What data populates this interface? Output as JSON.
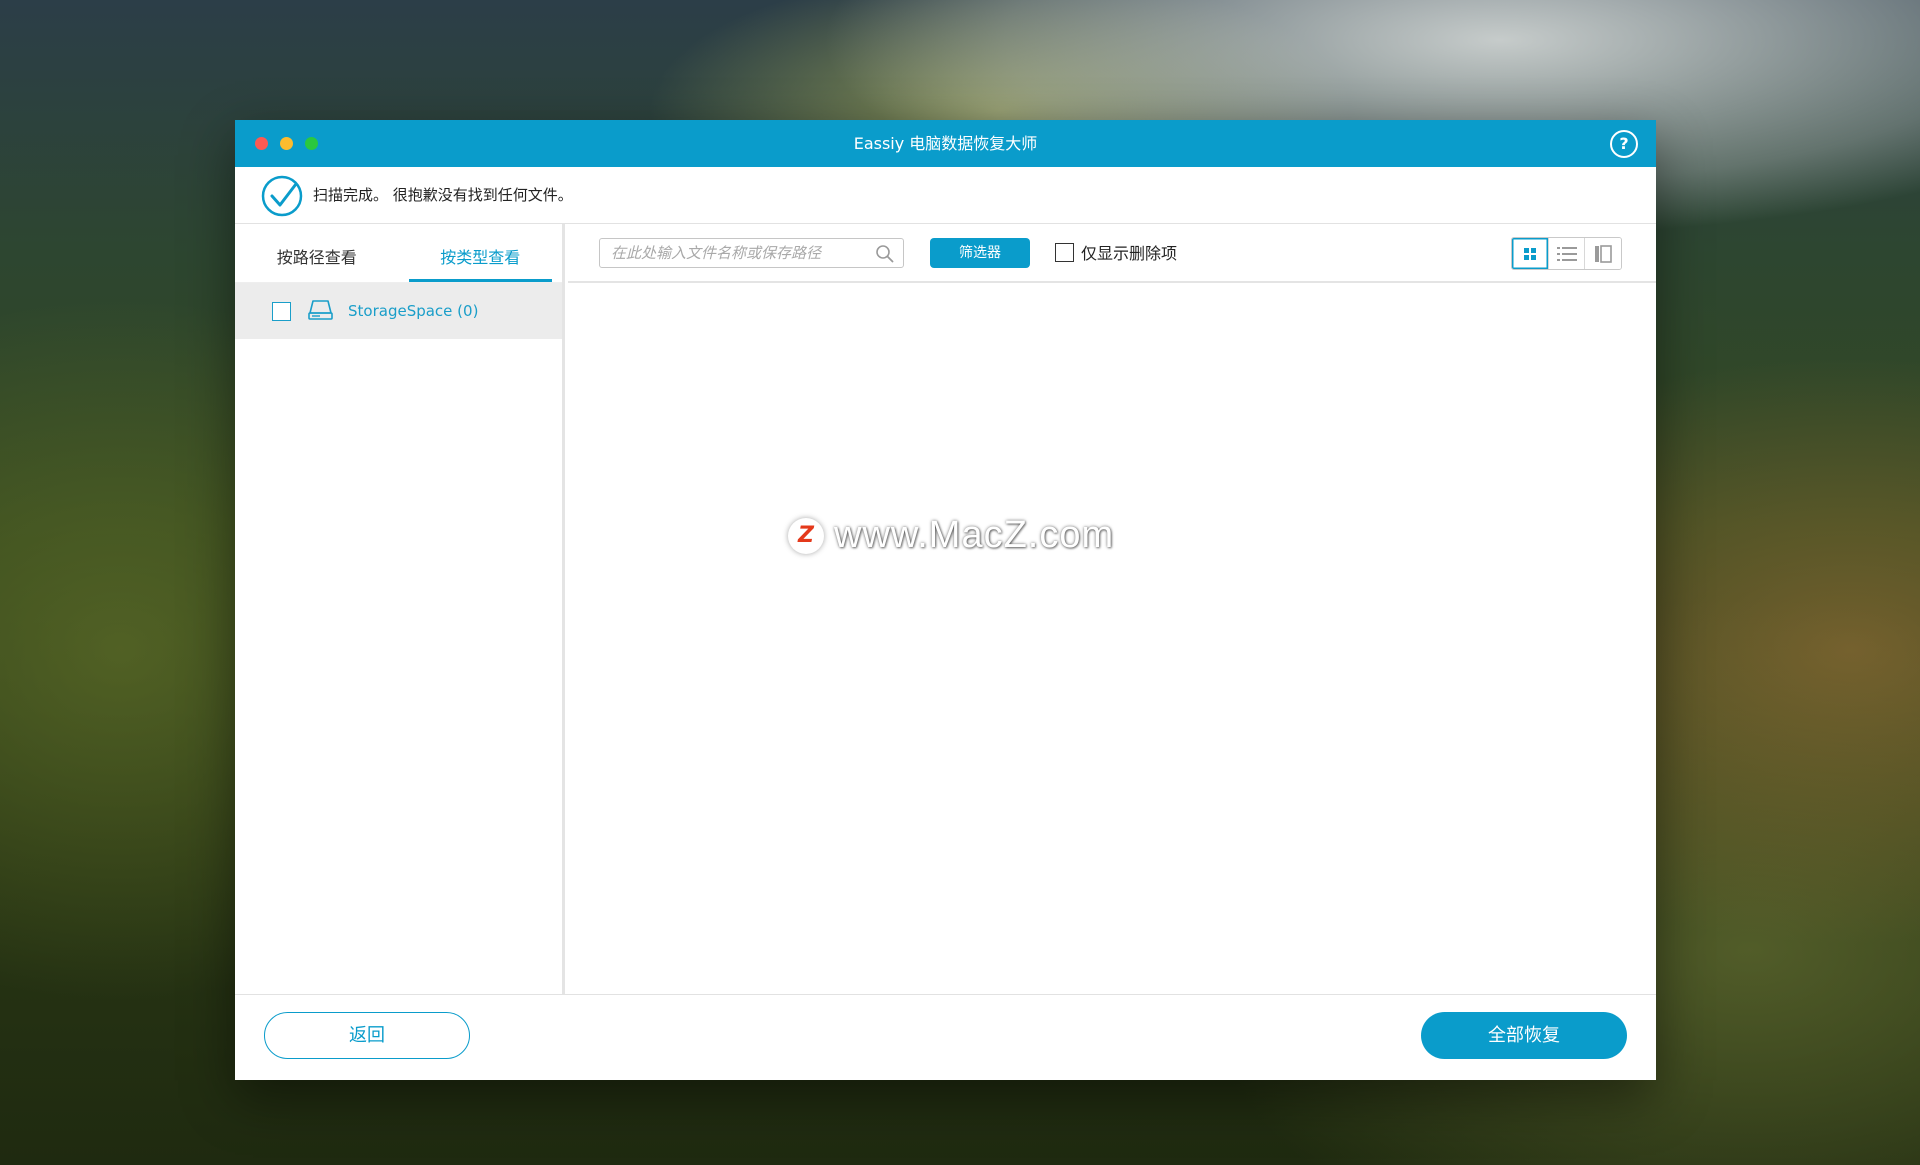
{
  "window": {
    "title": "Eassiy 电脑数据恢复大师",
    "help_icon": "question-circle-icon",
    "help_glyph": "?"
  },
  "status": {
    "icon": "check-circle-icon",
    "text": "扫描完成。 很抱歉没有找到任何文件。"
  },
  "sidebar": {
    "tabs": [
      {
        "label": "按路径查看",
        "active": false
      },
      {
        "label": "按类型查看",
        "active": true
      }
    ],
    "items": [
      {
        "label": "StorageSpace (0)",
        "icon": "drive-icon",
        "checked": false
      }
    ]
  },
  "toolbar": {
    "search_placeholder": "在此处输入文件名称或保存路径",
    "filter_label": "筛选器",
    "deleted_only_label": "仅显示删除项",
    "deleted_only_checked": false,
    "views": [
      "grid-view-icon",
      "list-view-icon",
      "column-view-icon"
    ],
    "active_view": "grid-view-icon"
  },
  "watermark": {
    "logo_glyph": "Z",
    "text": "www.MacZ.com"
  },
  "footer": {
    "back_label": "返回",
    "recover_all_label": "全部恢复"
  },
  "colors": {
    "accent": "#0a9ccb",
    "close": "#fd5a52",
    "minimize": "#fdbc2e",
    "maximize": "#2ac840"
  }
}
